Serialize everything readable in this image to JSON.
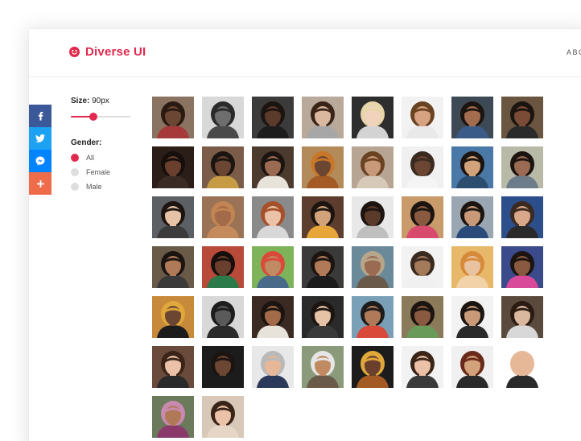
{
  "app": {
    "name": "Diverse UI"
  },
  "nav": {
    "about": "ABO"
  },
  "share": [
    {
      "icon": "facebook-icon",
      "color": "#3b5998"
    },
    {
      "icon": "twitter-icon",
      "color": "#1da1f2"
    },
    {
      "icon": "messenger-icon",
      "color": "#0084ff"
    },
    {
      "icon": "plus-icon",
      "color": "#ef6c4a"
    }
  ],
  "filters": {
    "size_label": "Size:",
    "size_value": "90px",
    "size_fraction": 0.38,
    "gender_label": "Gender:",
    "options": [
      {
        "label": "All",
        "selected": true
      },
      {
        "label": "Female",
        "selected": false
      },
      {
        "label": "Male",
        "selected": false
      }
    ]
  },
  "colors": {
    "accent": "#e0294c"
  },
  "avatars": [
    {
      "bg": "#8a7461",
      "skin": "#6b4632",
      "hair": "#2a1a12",
      "shirt": "#a63a3a"
    },
    {
      "bg": "#d8d8d8",
      "skin": "#6e6e6e",
      "hair": "#2b2b2b",
      "shirt": "#4a4a4a"
    },
    {
      "bg": "#3b3b3b",
      "skin": "#5a3a2a",
      "hair": "#1c1410",
      "shirt": "#1c1c1c"
    },
    {
      "bg": "#b8a99a",
      "skin": "#d9b89f",
      "hair": "#3a2418",
      "shirt": "#a7a7a7"
    },
    {
      "bg": "#2e2e2e",
      "skin": "#f1d2bd",
      "hair": "#e6d6a8",
      "shirt": "#d3d3d3"
    },
    {
      "bg": "#f2f2f2",
      "skin": "#d6a282",
      "hair": "#6a4322",
      "shirt": "#e9e9e9"
    },
    {
      "bg": "#3d4a55",
      "skin": "#a26c4e",
      "hair": "#1b1410",
      "shirt": "#3a5a88"
    },
    {
      "bg": "#6a5540",
      "skin": "#7a4c35",
      "hair": "#1b1410",
      "shirt": "#2a2a2a"
    },
    {
      "bg": "#2b1d17",
      "skin": "#6b3f2d",
      "hair": "#170f0c",
      "shirt": "#3b2b25"
    },
    {
      "bg": "#7a5c48",
      "skin": "#6b4632",
      "hair": "#1b1410",
      "shirt": "#c79a45"
    },
    {
      "bg": "#4b3a2e",
      "skin": "#9a6a52",
      "hair": "#1b1410",
      "shirt": "#e7e2da"
    },
    {
      "bg": "#b38b5a",
      "skin": "#6b4632",
      "hair": "#c8772a",
      "shirt": "#a35a24"
    },
    {
      "bg": "#b7a493",
      "skin": "#c89a7a",
      "hair": "#6a4322",
      "shirt": "#d7c9b8"
    },
    {
      "bg": "#f0f0f0",
      "skin": "#6b4632",
      "hair": "#3a2a20",
      "shirt": "#f5f5f5"
    },
    {
      "bg": "#4a79a7",
      "skin": "#d2a27a",
      "hair": "#1b1410",
      "shirt": "#2d4d6e"
    },
    {
      "bg": "#b9b9a8",
      "skin": "#9a6a52",
      "hair": "#1b1410",
      "shirt": "#6c7c8a"
    },
    {
      "bg": "#5c5f63",
      "skin": "#e6c2a6",
      "hair": "#1b1410",
      "shirt": "#3b3b3b"
    },
    {
      "bg": "#9a7356",
      "skin": "#a36a49",
      "hair": "#c28452",
      "shirt": "#c48a5c"
    },
    {
      "bg": "#8a8a8a",
      "skin": "#ebc2a7",
      "hair": "#a6502a",
      "shirt": "#d8d8d8"
    },
    {
      "bg": "#5c3d2e",
      "skin": "#d2a27a",
      "hair": "#1b1410",
      "shirt": "#e7a63a"
    },
    {
      "bg": "#e8e8e8",
      "skin": "#5a3a2a",
      "hair": "#1c1410",
      "shirt": "#bfbfbf"
    },
    {
      "bg": "#c99a6a",
      "skin": "#8a5a40",
      "hair": "#1b1410",
      "shirt": "#d94b6e"
    },
    {
      "bg": "#9aa7b3",
      "skin": "#c89a7a",
      "hair": "#1b1410",
      "shirt": "#2a4a7a"
    },
    {
      "bg": "#2c4e8a",
      "skin": "#d9a78a",
      "hair": "#3a2a20",
      "shirt": "#2a2a2a"
    },
    {
      "bg": "#6a5a48",
      "skin": "#b07a58",
      "hair": "#1b1410",
      "shirt": "#3a3a3a"
    },
    {
      "bg": "#b84a3a",
      "skin": "#6b3f2d",
      "hair": "#170f0c",
      "shirt": "#2a7a4a"
    },
    {
      "bg": "#7fb35a",
      "skin": "#c08a62",
      "hair": "#d94a3a",
      "shirt": "#4a6a8a"
    },
    {
      "bg": "#3a3a3a",
      "skin": "#b07a58",
      "hair": "#1b1410",
      "shirt": "#1c1c1c"
    },
    {
      "bg": "#6a8a9a",
      "skin": "#9a6a52",
      "hair": "#b6a68a",
      "shirt": "#6a5a4a"
    },
    {
      "bg": "#f2f2f2",
      "skin": "#a37a5a",
      "hair": "#3a2a20",
      "shirt": "#f0f0f0"
    },
    {
      "bg": "#e8b86a",
      "skin": "#e9c2a0",
      "hair": "#d68a3a",
      "shirt": "#f2d2a8"
    },
    {
      "bg": "#3a4a8a",
      "skin": "#8a5a40",
      "hair": "#1b1410",
      "shirt": "#d94b9a"
    },
    {
      "bg": "#c78a3a",
      "skin": "#6b4632",
      "hair": "#e0a83a",
      "shirt": "#1c1c1c"
    },
    {
      "bg": "#d8d8d8",
      "skin": "#5a5a5a",
      "hair": "#1c1c1c",
      "shirt": "#2b2b2b"
    },
    {
      "bg": "#3a2a22",
      "skin": "#a36a49",
      "hair": "#1b1410",
      "shirt": "#e7e2da"
    },
    {
      "bg": "#2a2a2a",
      "skin": "#e6c2a6",
      "hair": "#1b1410",
      "shirt": "#3a3a3a"
    },
    {
      "bg": "#7aa0b8",
      "skin": "#b07a58",
      "hair": "#1c1c1c",
      "shirt": "#d94a3a"
    },
    {
      "bg": "#8a7a5a",
      "skin": "#8a5a40",
      "hair": "#1b1410",
      "shirt": "#6a9a5a"
    },
    {
      "bg": "#f2f2f2",
      "skin": "#c89a7a",
      "hair": "#1b1410",
      "shirt": "#2a2a2a"
    },
    {
      "bg": "#5a4a3e",
      "skin": "#d9b89f",
      "hair": "#2a1a12",
      "shirt": "#d8d8d8"
    },
    {
      "bg": "#6a4a3a",
      "skin": "#ebc2a7",
      "hair": "#3a2418",
      "shirt": "#2a2a2a"
    },
    {
      "bg": "#1c1c1c",
      "skin": "#6b4632",
      "hair": "#1c1410",
      "shirt": "#1c1c1c"
    },
    {
      "bg": "#e8e8e8",
      "skin": "#e6b898",
      "hair": "#b9b9b9",
      "shirt": "#2b3a5a"
    },
    {
      "bg": "#8a9a7a",
      "skin": "#c08a62",
      "hair": "#e6e6e6",
      "shirt": "#6a5a4a"
    },
    {
      "bg": "#1c1c1c",
      "skin": "#6b3f2d",
      "hair": "#e0a83a",
      "shirt": "#a35a24"
    },
    {
      "bg": "#f2f2f2",
      "skin": "#ebc2a7",
      "hair": "#3a2418",
      "shirt": "#3a3a3a"
    },
    {
      "bg": "#f0f0f0",
      "skin": "#d2a27a",
      "hair": "#6a2a1a",
      "shirt": "#2a2a2a"
    },
    {
      "bg": "#ffffff",
      "skin": "#e6b898",
      "hair": "#e6b898",
      "shirt": "#2a2a2a"
    },
    {
      "bg": "#6a7a5a",
      "skin": "#b07a58",
      "hair": "#c88ab0",
      "shirt": "#8a3a6a"
    },
    {
      "bg": "#d8c8b8",
      "skin": "#ebc2a7",
      "hair": "#3a2418",
      "shirt": "#e6d6c6"
    }
  ]
}
